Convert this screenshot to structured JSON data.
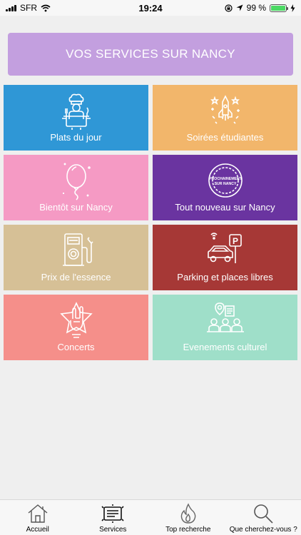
{
  "status": {
    "carrier": "SFR",
    "time": "19:24",
    "battery": "99 %",
    "battery_level": 0.99
  },
  "header": {
    "title": "VOS SERVICES SUR NANCY",
    "color": "#c39fdf"
  },
  "tiles": [
    {
      "label": "Plats du jour",
      "icon": "chef-icon",
      "color": "#2f97d6"
    },
    {
      "label": "Soirées étudiantes",
      "icon": "fireworks-icon",
      "color": "#f2b66b"
    },
    {
      "label": "Bientôt sur Nancy",
      "icon": "balloon-icon",
      "color": "#f59ac4"
    },
    {
      "label": "Tout nouveau sur Nancy",
      "icon": "badge-icon",
      "badge_text_1": "PROCHAINEMENT",
      "badge_text_2": "SUR NANCY",
      "color": "#6a34a0"
    },
    {
      "label": "Prix de l'essence",
      "icon": "gas-pump-icon",
      "color": "#d6c096"
    },
    {
      "label": "Parking et places libres",
      "icon": "parking-icon",
      "parking_letter": "P",
      "color": "#a63836"
    },
    {
      "label": "Concerts",
      "icon": "rock-hand-icon",
      "color": "#f58f8a"
    },
    {
      "label": "Evenements culturel",
      "icon": "people-event-icon",
      "color": "#9fdfc9"
    }
  ],
  "tabs": [
    {
      "label": "Accueil",
      "icon": "home-icon"
    },
    {
      "label": "Services",
      "icon": "services-icon"
    },
    {
      "label": "Top recherche",
      "icon": "flame-icon"
    },
    {
      "label": "Que cherchez-vous ?",
      "icon": "search-icon"
    }
  ]
}
